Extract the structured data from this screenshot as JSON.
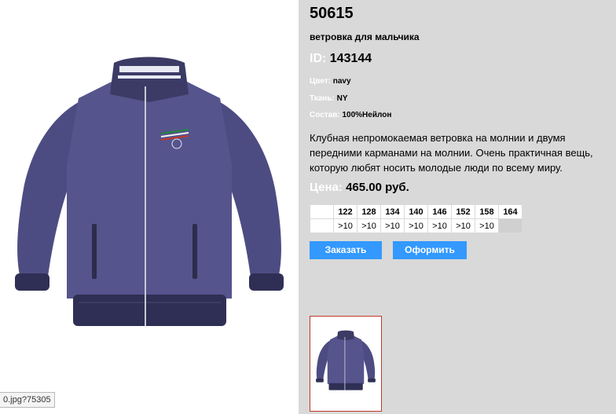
{
  "product": {
    "article": "50615",
    "subtitle": "ветровка для мальчика",
    "id_label": "ID:",
    "id_value": "143144",
    "props": [
      {
        "label": "Цвет:",
        "value": "navy"
      },
      {
        "label": "Ткань:",
        "value": "NY"
      },
      {
        "label": "Состав:",
        "value": "100%Нейлон"
      }
    ],
    "description": "Клубная непромокаемая ветровка на молнии и двумя передними карманами на молнии. Очень практичная вещь, которую любят носить молодые люди по всему миру.",
    "price_label": "Цена:",
    "price_value": "465.00 руб."
  },
  "sizes": {
    "headers": [
      "122",
      "128",
      "134",
      "140",
      "146",
      "152",
      "158",
      "164"
    ],
    "quantities": [
      ">10",
      ">10",
      ">10",
      ">10",
      ">10",
      ">10",
      ">10",
      ""
    ]
  },
  "buttons": {
    "order": "Заказать",
    "checkout": "Оформить"
  },
  "status_bar": {
    "url": "0.jpg?75305"
  },
  "colors": {
    "panel_bg": "#d9d9d9",
    "button_bg": "#3399ff",
    "jacket": "#4a4a7e",
    "thumb_border": "#c0392b"
  },
  "icons": [
    "jacket-image",
    "jacket-thumbnail"
  ]
}
